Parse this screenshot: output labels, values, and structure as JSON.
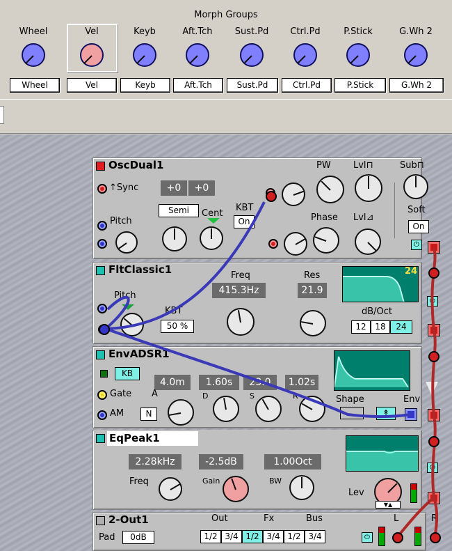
{
  "morph": {
    "title": "Morph Groups",
    "groups": [
      {
        "label": "Wheel",
        "box": "Wheel",
        "color": "#8080ff"
      },
      {
        "label": "Vel",
        "box": "Vel",
        "color": "#f0a0a0"
      },
      {
        "label": "Keyb",
        "box": "Keyb",
        "color": "#8080ff"
      },
      {
        "label": "Aft.Tch",
        "box": "Aft.Tch",
        "color": "#8080ff"
      },
      {
        "label": "Sust.Pd",
        "box": "Sust.Pd",
        "color": "#8080ff"
      },
      {
        "label": "Ctrl.Pd",
        "box": "Ctrl.Pd",
        "color": "#8080ff"
      },
      {
        "label": "P.Stick",
        "box": "P.Stick",
        "color": "#8080ff"
      },
      {
        "label": "G.Wh 2",
        "box": "G.Wh 2",
        "color": "#8080ff"
      }
    ]
  },
  "osc": {
    "title": "OscDual1",
    "sync": "Sync",
    "coarse": "+0",
    "fine": "+0",
    "semi": "Semi",
    "cent": "Cent",
    "kbt": "KBT",
    "kbt_value": "On",
    "pitch": "Pitch",
    "pw": "PW",
    "lvl_sq": "Lvl",
    "sub": "Sub",
    "phase": "Phase",
    "lvl_saw": "Lvl",
    "soft": "Soft",
    "soft_value": "On"
  },
  "filter": {
    "title": "FltClassic1",
    "freq_label": "Freq",
    "freq_value": "415.3Hz",
    "res_label": "Res",
    "res_value": "21.9",
    "pitch": "Pitch",
    "kbt": "KBT",
    "kbt_value": "50 %",
    "slope_label": "dB/Oct",
    "slope_display": "24",
    "slopes": [
      "12",
      "18",
      "24"
    ]
  },
  "env": {
    "title": "EnvADSR1",
    "kb": "KB",
    "attack": "4.0m",
    "decay": "1.60s",
    "sustain": "23.0",
    "release": "1.02s",
    "gate": "Gate",
    "am": "AM",
    "am_value": "N",
    "a": "A",
    "d": "D",
    "s": "S",
    "r": "R",
    "shape": "Shape",
    "env": "Env"
  },
  "eq": {
    "title": "EqPeak1",
    "freq_value": "2.28kHz",
    "gain_value": "-2.5dB",
    "bw_value": "1.00Oct",
    "freq_label": "Freq",
    "gain_label": "Gain",
    "bw_label": "BW",
    "lev_label": "Lev"
  },
  "out": {
    "title": "2-Out1",
    "out_label": "Out",
    "fx_label": "Fx",
    "bus_label": "Bus",
    "pad_label": "Pad",
    "pad_value": "0dB",
    "routes": [
      "1/2",
      "3/4",
      "1/2",
      "3/4",
      "1/2",
      "3/4"
    ],
    "l_label": "L",
    "r_label": "R"
  },
  "colors": {
    "accent_cyan": "#7ff0e6",
    "cable_blue": "#3a3ab8",
    "cable_red": "#b02828",
    "value_box": "#6b6b6b"
  }
}
